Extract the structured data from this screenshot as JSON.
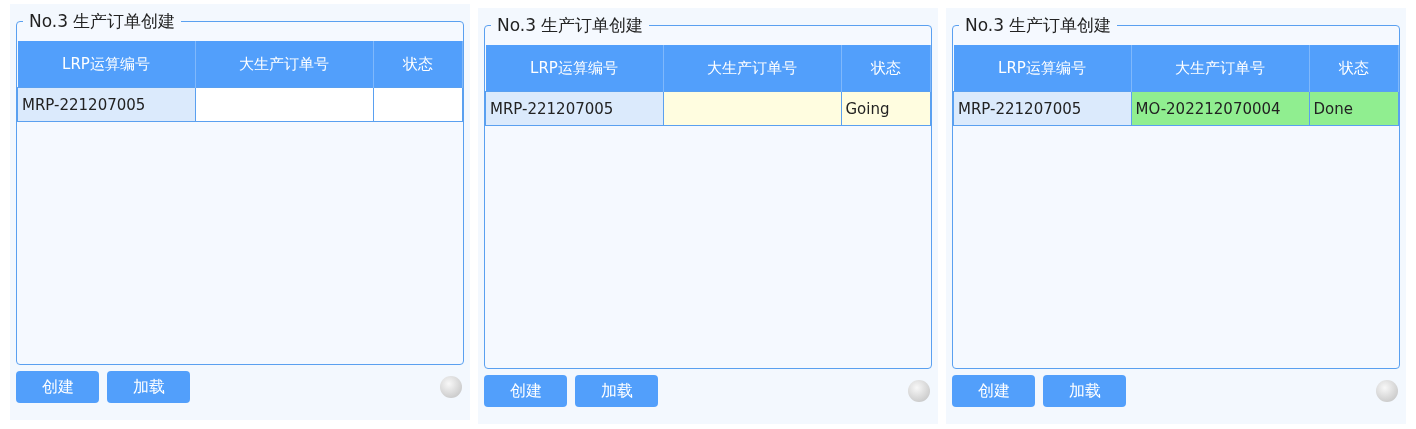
{
  "panels": [
    {
      "title": "No.3 生产订单创建",
      "columns": [
        "LRP运算编号",
        "大生产订单号",
        "状态"
      ],
      "rows": [
        {
          "kind": "idle",
          "cells": [
            "MRP-221207005",
            "",
            ""
          ]
        }
      ],
      "buttons": [
        "创建",
        "加载"
      ],
      "indicator": {
        "on": false
      }
    },
    {
      "title": "No.3 生产订单创建",
      "columns": [
        "LRP运算编号",
        "大生产订单号",
        "状态"
      ],
      "rows": [
        {
          "kind": "going",
          "cells": [
            "MRP-221207005",
            "",
            "Going"
          ]
        }
      ],
      "buttons": [
        "创建",
        "加载"
      ],
      "indicator": {
        "on": false
      }
    },
    {
      "title": "No.3 生产订单创建",
      "columns": [
        "LRP运算编号",
        "大生产订单号",
        "状态"
      ],
      "rows": [
        {
          "kind": "done",
          "cells": [
            "MRP-221207005",
            "MO-202212070004",
            "Done"
          ]
        }
      ],
      "buttons": [
        "创建",
        "加载"
      ],
      "indicator": {
        "on": false
      }
    }
  ]
}
